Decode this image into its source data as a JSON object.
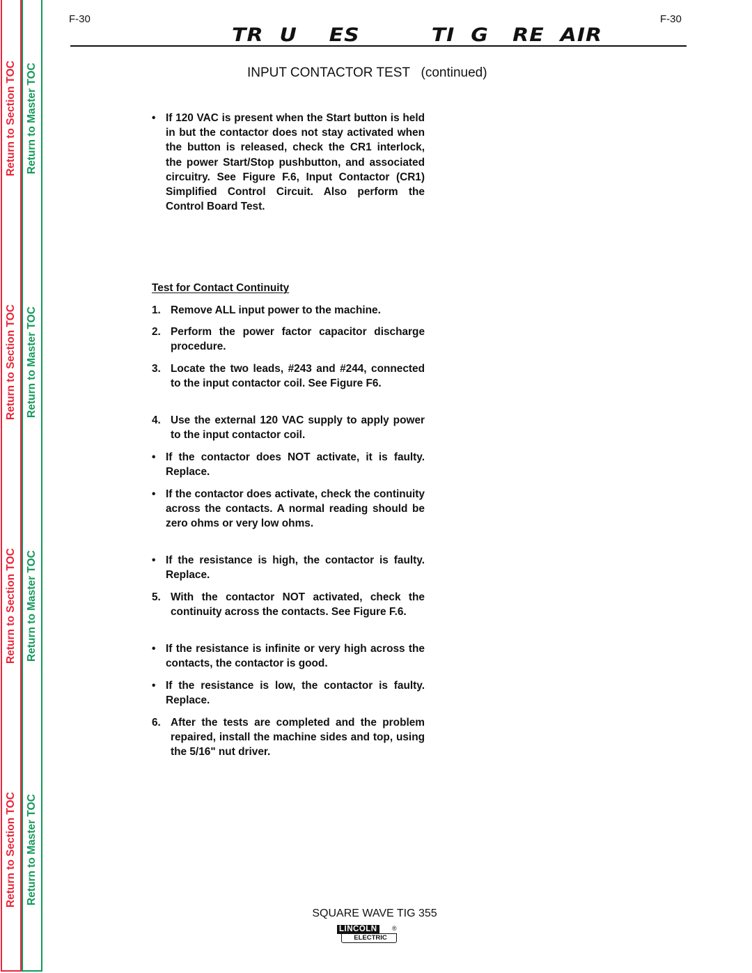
{
  "side_tabs": {
    "section_label": "Return to Section TOC",
    "master_label": "Return to Master TOC",
    "colors": {
      "section": "#e8263b",
      "master": "#139a5a"
    }
  },
  "header": {
    "page_left": "F-30",
    "page_right": "F-30",
    "title": "TR  U    ES         TI  G   RE  AIR",
    "subtitle": "INPUT CONTACTOR TEST   (continued)"
  },
  "body": {
    "intro_bullet": "If 120 VAC is present when the Start button is held in but the contactor does not stay activated when the button is released, check the CR1 interlock, the power Start/Stop pushbutton, and associated circuitry.  See Figure F.6, Input Contactor (CR1) Simplified Control Circuit.  Also perform the Control Board Test.",
    "section_heading": "Test for Contact Continuity",
    "bullet_mark": "•",
    "steps": [
      {
        "num": "1.",
        "text": "Remove ALL input power to the machine."
      },
      {
        "num": "2.",
        "text": "Perform the power factor capacitor discharge procedure."
      },
      {
        "num": "3.",
        "text": "Locate the two leads, #243 and #244, connected to the input contactor coil.  See Figure F6."
      },
      {
        "num": "4.",
        "text": "Use the external 120 VAC supply to apply power to the input contactor coil."
      },
      {
        "num": "•",
        "text": "If the contactor does NOT activate, it is faulty.  Replace."
      },
      {
        "num": "•",
        "text": "If the contactor does activate, check the continuity across the contacts.  A normal reading should be zero ohms or very low ohms."
      },
      {
        "num": "•",
        "text": "If the resistance is high, the contactor is faulty.  Replace."
      },
      {
        "num": "5.",
        "text": "With the contactor NOT activated, check the continuity across the contacts.  See Figure F.6."
      },
      {
        "num": "•",
        "text": "If the resistance is infinite or very high across the contacts, the contactor is good."
      },
      {
        "num": "•",
        "text": "If the resistance is low, the contactor is faulty.  Replace."
      },
      {
        "num": "6.",
        "text": "After the tests are completed and the problem repaired, install the machine sides and top, using the 5/16\" nut driver."
      }
    ]
  },
  "footer": {
    "model": "SQUARE WAVE TIG 355",
    "logo_top": "LINCOLN",
    "logo_bottom": "ELECTRIC",
    "logo_reg": "®"
  }
}
